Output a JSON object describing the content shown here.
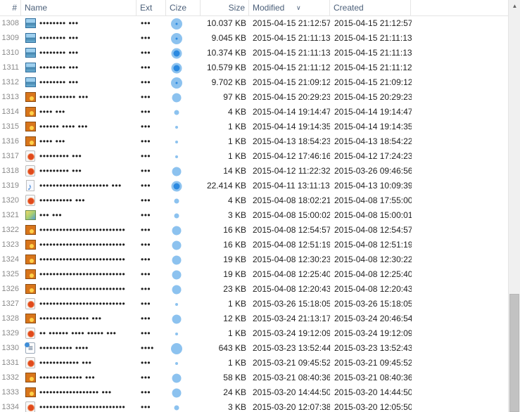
{
  "columns": {
    "num": "#",
    "name": "Name",
    "ext": "Ext",
    "cize": "Cize",
    "size": "Size",
    "modified": "Modified",
    "created": "Created"
  },
  "colors": {
    "dot_light": "#8cc2ef",
    "dot_dark": "#2b89e0",
    "header_text": "#4c607a"
  },
  "rows": [
    {
      "num": "1308",
      "icon": "image-file-icon",
      "name": "•••••••• •••",
      "ext": "•••",
      "cize": "ring-center",
      "size": "10.037 KB",
      "modified": "2015-04-15 21:12:57",
      "created": "2015-04-15 21:12:57"
    },
    {
      "num": "1309",
      "icon": "image-file-icon",
      "name": "•••••••• •••",
      "ext": "•••",
      "cize": "ring-center",
      "size": "9.045 KB",
      "modified": "2015-04-15 21:11:13",
      "created": "2015-04-15 21:11:13"
    },
    {
      "num": "1310",
      "icon": "image-file-icon",
      "name": "•••••••• •••",
      "ext": "•••",
      "cize": "ring",
      "size": "10.374 KB",
      "modified": "2015-04-15 21:11:13",
      "created": "2015-04-15 21:11:13"
    },
    {
      "num": "1311",
      "icon": "image-file-icon",
      "name": "•••••••• •••",
      "ext": "•••",
      "cize": "ring",
      "size": "10.579 KB",
      "modified": "2015-04-15 21:11:12",
      "created": "2015-04-15 21:11:12"
    },
    {
      "num": "1312",
      "icon": "image-file-icon",
      "name": "•••••••• •••",
      "ext": "•••",
      "cize": "ring-center",
      "size": "9.702 KB",
      "modified": "2015-04-15 21:09:12",
      "created": "2015-04-15 21:09:12"
    },
    {
      "num": "1313",
      "icon": "orange-image-icon",
      "name": "••••••••••• •••",
      "ext": "•••",
      "cize": "large",
      "size": "97 KB",
      "modified": "2015-04-15 20:29:23",
      "created": "2015-04-15 20:29:23"
    },
    {
      "num": "1314",
      "icon": "orange-image-icon",
      "name": "•••• •••",
      "ext": "•••",
      "cize": "small",
      "size": "4 KB",
      "modified": "2015-04-14 19:14:47",
      "created": "2015-04-14 19:14:47"
    },
    {
      "num": "1315",
      "icon": "orange-image-icon",
      "name": "•••••• •••• •••",
      "ext": "•••",
      "cize": "tiny",
      "size": "1 KB",
      "modified": "2015-04-14 19:14:35",
      "created": "2015-04-14 19:14:35"
    },
    {
      "num": "1316",
      "icon": "orange-image-icon",
      "name": "•••• •••",
      "ext": "•••",
      "cize": "tiny",
      "size": "1 KB",
      "modified": "2015-04-13 18:54:23",
      "created": "2015-04-13 18:54:22"
    },
    {
      "num": "1317",
      "icon": "red-circle-file-icon",
      "name": "••••••••• •••",
      "ext": "•••",
      "cize": "tiny",
      "size": "1 KB",
      "modified": "2015-04-12 17:46:16",
      "created": "2015-04-12 17:24:23"
    },
    {
      "num": "1318",
      "icon": "red-circle-file-icon",
      "name": "••••••••• •••",
      "ext": "•••",
      "cize": "large",
      "size": "14 KB",
      "modified": "2015-04-12 11:22:32",
      "created": "2015-03-26 09:46:56"
    },
    {
      "num": "1319",
      "icon": "music-file-icon",
      "name": "••••••••••••••••••••• •••",
      "ext": "•••",
      "cize": "ring",
      "size": "22.414 KB",
      "modified": "2015-04-11 13:11:13",
      "created": "2015-04-13 10:09:39"
    },
    {
      "num": "1320",
      "icon": "red-circle-file-icon",
      "name": "•••••••••• •••",
      "ext": "•••",
      "cize": "small",
      "size": "4 KB",
      "modified": "2015-04-08 18:02:21",
      "created": "2015-04-08 17:55:00"
    },
    {
      "num": "1321",
      "icon": "picture-file-icon",
      "name": "••• •••",
      "ext": "•••",
      "cize": "small",
      "size": "3 KB",
      "modified": "2015-04-08 15:00:02",
      "created": "2015-04-08 15:00:01"
    },
    {
      "num": "1322",
      "icon": "orange-image-icon",
      "name": "••••••••••••••••••••••••••",
      "ext": "•••",
      "cize": "large",
      "size": "16 KB",
      "modified": "2015-04-08 12:54:57",
      "created": "2015-04-08 12:54:57"
    },
    {
      "num": "1323",
      "icon": "orange-image-icon",
      "name": "••••••••••••••••••••••••••",
      "ext": "•••",
      "cize": "large",
      "size": "16 KB",
      "modified": "2015-04-08 12:51:19",
      "created": "2015-04-08 12:51:19"
    },
    {
      "num": "1324",
      "icon": "orange-image-icon",
      "name": "••••••••••••••••••••••••••",
      "ext": "•••",
      "cize": "large",
      "size": "19 KB",
      "modified": "2015-04-08 12:30:23",
      "created": "2015-04-08 12:30:22"
    },
    {
      "num": "1325",
      "icon": "orange-image-icon",
      "name": "••••••••••••••••••••••••••",
      "ext": "•••",
      "cize": "large",
      "size": "19 KB",
      "modified": "2015-04-08 12:25:40",
      "created": "2015-04-08 12:25:40"
    },
    {
      "num": "1326",
      "icon": "orange-image-icon",
      "name": "••••••••••••••••••••••••••",
      "ext": "•••",
      "cize": "large",
      "size": "23 KB",
      "modified": "2015-04-08 12:20:43",
      "created": "2015-04-08 12:20:43"
    },
    {
      "num": "1327",
      "icon": "red-circle-file-icon",
      "name": "••••••••••••••••••••••••••",
      "ext": "•••",
      "cize": "tiny",
      "size": "1 KB",
      "modified": "2015-03-26 15:18:05",
      "created": "2015-03-26 15:18:05"
    },
    {
      "num": "1328",
      "icon": "orange-image-icon",
      "name": "••••••••••••••• •••",
      "ext": "•••",
      "cize": "large",
      "size": "12 KB",
      "modified": "2015-03-24 21:13:17",
      "created": "2015-03-24 20:46:54"
    },
    {
      "num": "1329",
      "icon": "red-circle-file-icon",
      "name": "•• •••••• •••• ••••• •••",
      "ext": "•••",
      "cize": "tiny",
      "size": "1 KB",
      "modified": "2015-03-24 19:12:09",
      "created": "2015-03-24 19:12:09"
    },
    {
      "num": "1330",
      "icon": "document-file-icon",
      "name": "•••••••••• ••••",
      "ext": "••••",
      "cize": "xlarge",
      "size": "643 KB",
      "modified": "2015-03-23 13:52:44",
      "created": "2015-03-23 13:52:43"
    },
    {
      "num": "1331",
      "icon": "red-circle-file-icon",
      "name": "•••••••••••• •••",
      "ext": "•••",
      "cize": "tiny",
      "size": "1 KB",
      "modified": "2015-03-21 09:45:52",
      "created": "2015-03-21 09:45:52"
    },
    {
      "num": "1332",
      "icon": "orange-image-icon",
      "name": "••••••••••••• •••",
      "ext": "•••",
      "cize": "large",
      "size": "58 KB",
      "modified": "2015-03-21 08:40:36",
      "created": "2015-03-21 08:40:36"
    },
    {
      "num": "1333",
      "icon": "orange-image-icon",
      "name": "•••••••••••••••••• •••",
      "ext": "•••",
      "cize": "large",
      "size": "24 KB",
      "modified": "2015-03-20 14:44:50",
      "created": "2015-03-20 14:44:50"
    },
    {
      "num": "1334",
      "icon": "red-circle-file-icon",
      "name": "••••••••••••••••••••••••••",
      "ext": "•••",
      "cize": "small",
      "size": "3 KB",
      "modified": "2015-03-20 12:07:38",
      "created": "2015-03-20 12:05:50"
    }
  ]
}
